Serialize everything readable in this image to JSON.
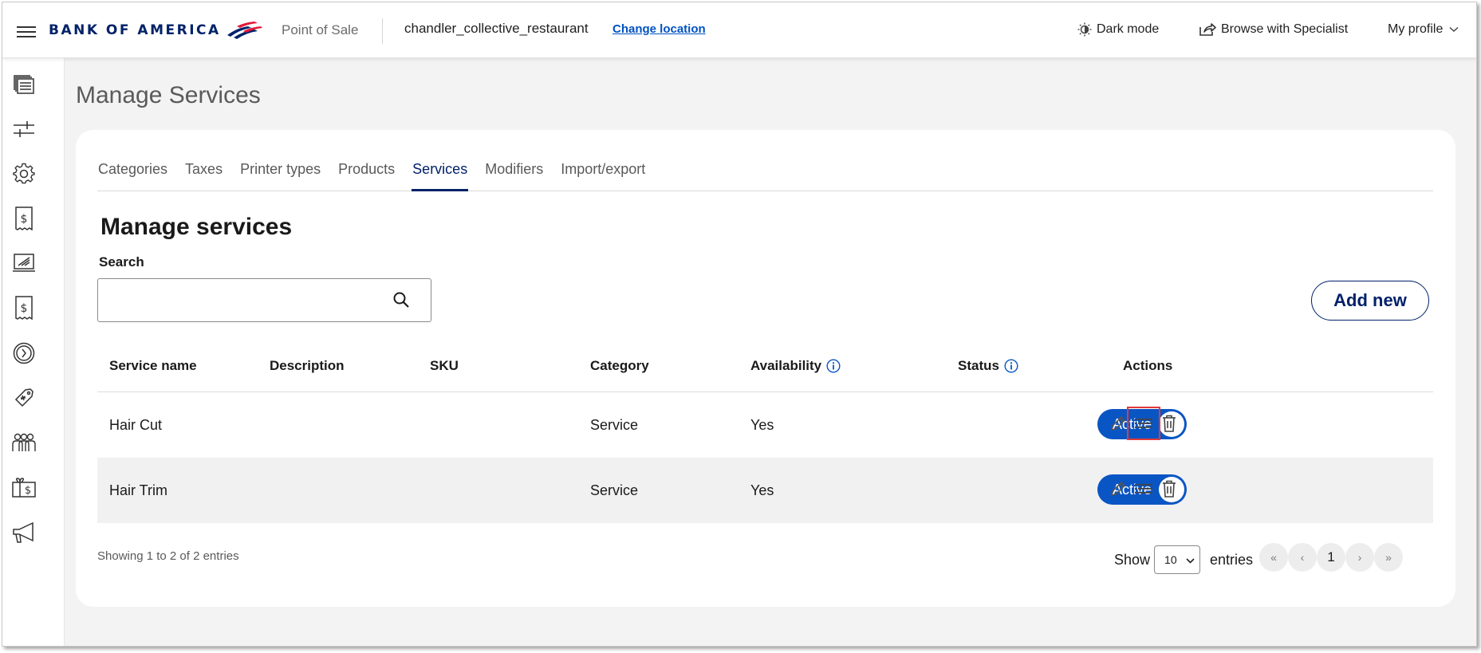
{
  "header": {
    "brand": "BANK OF AMERICA",
    "app_name": "Point of Sale",
    "location": "chandler_collective_restaurant",
    "change_location": "Change location",
    "dark_mode": "Dark mode",
    "browse_specialist": "Browse with Specialist",
    "my_profile": "My profile"
  },
  "sidebar": {
    "icons": [
      "orders-icon",
      "sliders-icon",
      "settings-icon",
      "receipt-dollar-icon",
      "register-icon",
      "receipt-dollar-icon",
      "clock-icon",
      "tag-icon",
      "customers-icon",
      "gift-card-icon",
      "megaphone-icon"
    ]
  },
  "page": {
    "title": "Manage Services"
  },
  "tabs": [
    {
      "label": "Categories",
      "active": false
    },
    {
      "label": "Taxes",
      "active": false
    },
    {
      "label": "Printer types",
      "active": false
    },
    {
      "label": "Products",
      "active": false
    },
    {
      "label": "Services",
      "active": true
    },
    {
      "label": "Modifiers",
      "active": false
    },
    {
      "label": "Import/export",
      "active": false
    }
  ],
  "section": {
    "title": "Manage services",
    "search_label": "Search",
    "search_value": "",
    "add_new": "Add new"
  },
  "table": {
    "headers": {
      "service_name": "Service name",
      "description": "Description",
      "sku": "SKU",
      "category": "Category",
      "availability": "Availability",
      "status": "Status",
      "actions": "Actions"
    },
    "rows": [
      {
        "service_name": "Hair Cut",
        "description": "",
        "sku": "",
        "category": "Service",
        "availability": "Yes",
        "status": "Active"
      },
      {
        "service_name": "Hair Trim",
        "description": "",
        "sku": "",
        "category": "Service",
        "availability": "Yes",
        "status": "Active"
      }
    ]
  },
  "footer": {
    "showing": "Showing 1 to 2 of 2 entries",
    "show": "Show",
    "page_size": "10",
    "entries": "entries",
    "first": "«",
    "prev": "‹",
    "current_page": "1",
    "next": "›",
    "last": "»"
  },
  "colors": {
    "brand_navy": "#012169",
    "brand_red": "#e31837",
    "toggle_blue": "#0a55c4",
    "highlight_red": "#e03a3a"
  }
}
